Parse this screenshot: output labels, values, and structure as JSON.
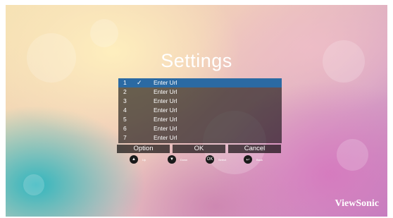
{
  "screen": {
    "title": "Settings",
    "url_list": [
      {
        "index": "1",
        "checked": true,
        "label": "Enter Url"
      },
      {
        "index": "2",
        "checked": false,
        "label": "Enter Url"
      },
      {
        "index": "3",
        "checked": false,
        "label": "Enter Url"
      },
      {
        "index": "4",
        "checked": false,
        "label": "Enter Url"
      },
      {
        "index": "5",
        "checked": false,
        "label": "Enter Url"
      },
      {
        "index": "6",
        "checked": false,
        "label": "Enter Url"
      },
      {
        "index": "7",
        "checked": false,
        "label": "Enter Url"
      }
    ],
    "check_glyph": "✓",
    "buttons": {
      "option": "Option",
      "ok": "OK",
      "cancel": "Cancel"
    },
    "hints": {
      "up": {
        "key": "▲",
        "label": "Up"
      },
      "down": {
        "key": "▼",
        "label": "Down"
      },
      "select": {
        "key": "OK",
        "label": "Select"
      },
      "back": {
        "key": "↩",
        "label": "Back"
      }
    },
    "brand": "ViewSonic"
  },
  "colors": {
    "selection": "#2b6aa3",
    "panel": "rgba(0,0,0,0.58)"
  }
}
